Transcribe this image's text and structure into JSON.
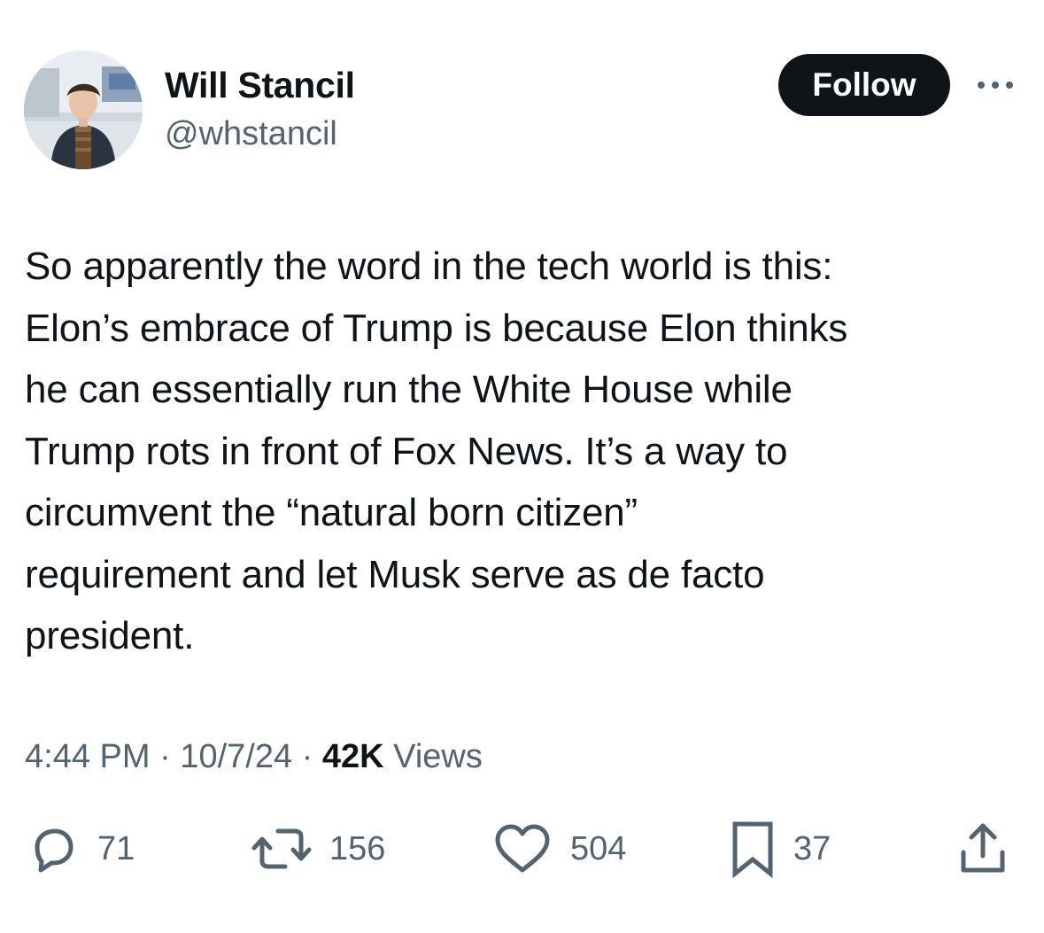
{
  "author": {
    "name": "Will Stancil",
    "handle": "@whstancil"
  },
  "follow_label": "Follow",
  "tweet": {
    "text": "So apparently the word in the tech world is this:\nElon’s embrace of Trump is because Elon thinks\nhe can essentially run the White House while\nTrump rots in front of Fox News. It’s a way to\ncircumvent the “natural born citizen”\nrequirement and let Musk serve as de facto\npresident."
  },
  "meta": {
    "time": "4:44 PM",
    "date": "10/7/24",
    "separator": "·",
    "views_count": "42K",
    "views_label": "Views"
  },
  "actions": {
    "replies": "71",
    "reposts": "156",
    "likes": "504",
    "bookmarks": "37"
  },
  "icons": {
    "more": "more-horizontal-icon",
    "reply": "reply-bubble-icon",
    "repost": "repost-arrows-icon",
    "like": "heart-icon",
    "bookmark": "bookmark-icon",
    "share": "share-upload-icon"
  },
  "colors": {
    "text": "#0f1419",
    "secondary": "#536471",
    "button_bg": "#0f1419",
    "button_text": "#ffffff"
  }
}
